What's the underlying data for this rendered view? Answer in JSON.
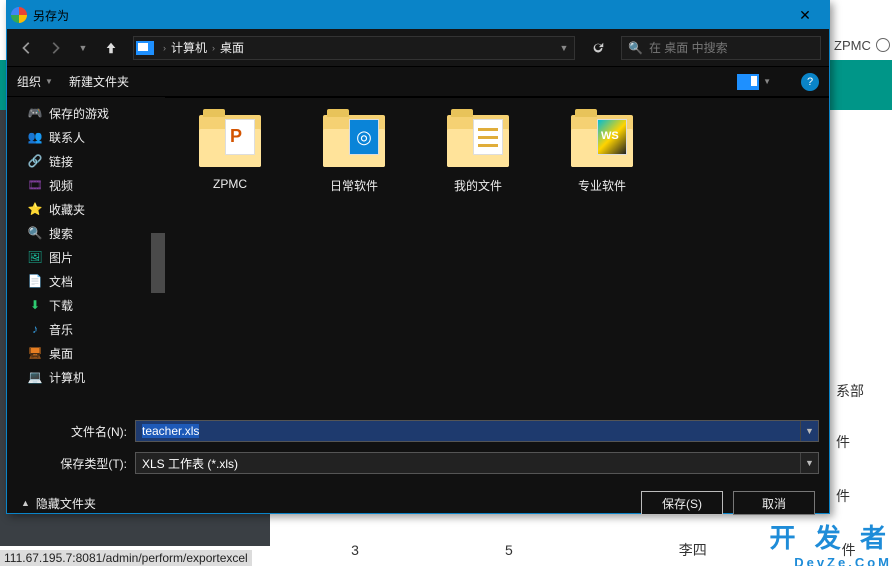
{
  "dialog": {
    "title": "另存为",
    "path": {
      "root": "计算机",
      "folder": "桌面"
    },
    "search_placeholder": "在 桌面 中搜索",
    "organize": "组织",
    "new_folder": "新建文件夹",
    "help_char": "?",
    "filename_label": "文件名(N):",
    "filename_value": "teacher.xls",
    "filetype_label": "保存类型(T):",
    "filetype_value": "XLS 工作表 (*.xls)",
    "hide_folders": "隐藏文件夹",
    "save_btn": "保存(S)",
    "cancel_btn": "取消"
  },
  "sidebar_items": [
    {
      "label": "保存的游戏",
      "icon": "game"
    },
    {
      "label": "联系人",
      "icon": "contacts"
    },
    {
      "label": "链接",
      "icon": "link"
    },
    {
      "label": "视频",
      "icon": "video"
    },
    {
      "label": "收藏夹",
      "icon": "fav"
    },
    {
      "label": "搜索",
      "icon": "search"
    },
    {
      "label": "图片",
      "icon": "pic"
    },
    {
      "label": "文档",
      "icon": "doc"
    },
    {
      "label": "下载",
      "icon": "down"
    },
    {
      "label": "音乐",
      "icon": "music"
    },
    {
      "label": "桌面",
      "icon": "desk"
    },
    {
      "label": "计算机",
      "icon": "pc"
    }
  ],
  "files": [
    {
      "label": "ZPMC",
      "badge": "ppt"
    },
    {
      "label": "日常软件",
      "badge": "blue"
    },
    {
      "label": "我的文件",
      "badge": "docs"
    },
    {
      "label": "专业软件",
      "badge": "apps"
    }
  ],
  "bg": {
    "zpmc": "ZPMC",
    "col_a": "3",
    "col_b": "5",
    "col_c": "李四",
    "row_right1": "系部",
    "row_right2": "件",
    "row_right3": "件",
    "row_right4": "件",
    "status_url": "111.67.195.7:8081/admin/perform/exportexcel",
    "wm_top": "开 发 者",
    "wm_sub": "DevZe.CoM"
  }
}
